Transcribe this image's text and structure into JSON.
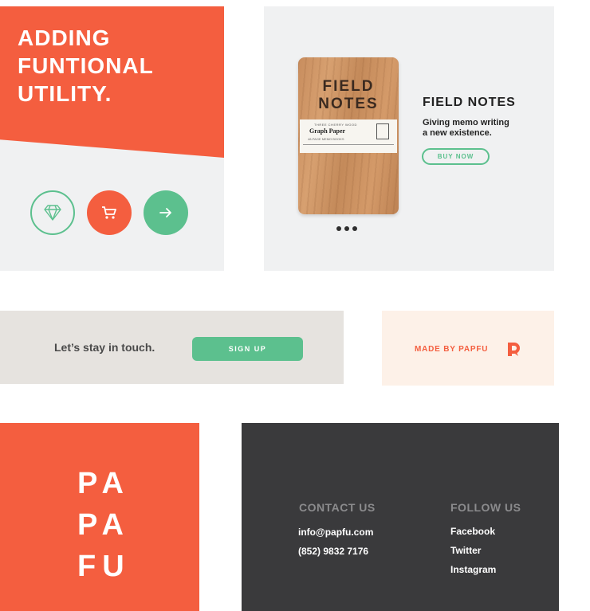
{
  "hero": {
    "headline": "ADDING\nFUNTIONAL\nUTILITY."
  },
  "product": {
    "notebook_title": "FIELD\nNOTES",
    "notebook_label_small": "THREE CHERRY WOOD",
    "notebook_label_main": "Graph Paper",
    "notebook_label_sub": "48-PAGE MEMO BOOKS",
    "title": "FIELD NOTES",
    "description": "Giving memo writing\na new existence.",
    "buy_label": "BUY NOW"
  },
  "newsletter": {
    "text": "Let’s stay in touch.",
    "button_label": "SIGN UP"
  },
  "madeby": {
    "text": "MADE BY PAPFU"
  },
  "brand": {
    "word": "PA\nPA\nFU"
  },
  "footer": {
    "contact_heading": "CONTACT US",
    "email": "info@papfu.com",
    "phone": "(852) 9832 7176",
    "follow_heading": "FOLLOW US",
    "social": [
      "Facebook",
      "Twitter",
      "Instagram"
    ]
  },
  "colors": {
    "accent_red": "#f45e3f",
    "accent_green": "#5cc08e",
    "footer_dark": "#3a3a3c"
  },
  "icons": [
    "gem-icon",
    "cart-icon",
    "arrow-right-icon",
    "papfu-logo-icon"
  ]
}
